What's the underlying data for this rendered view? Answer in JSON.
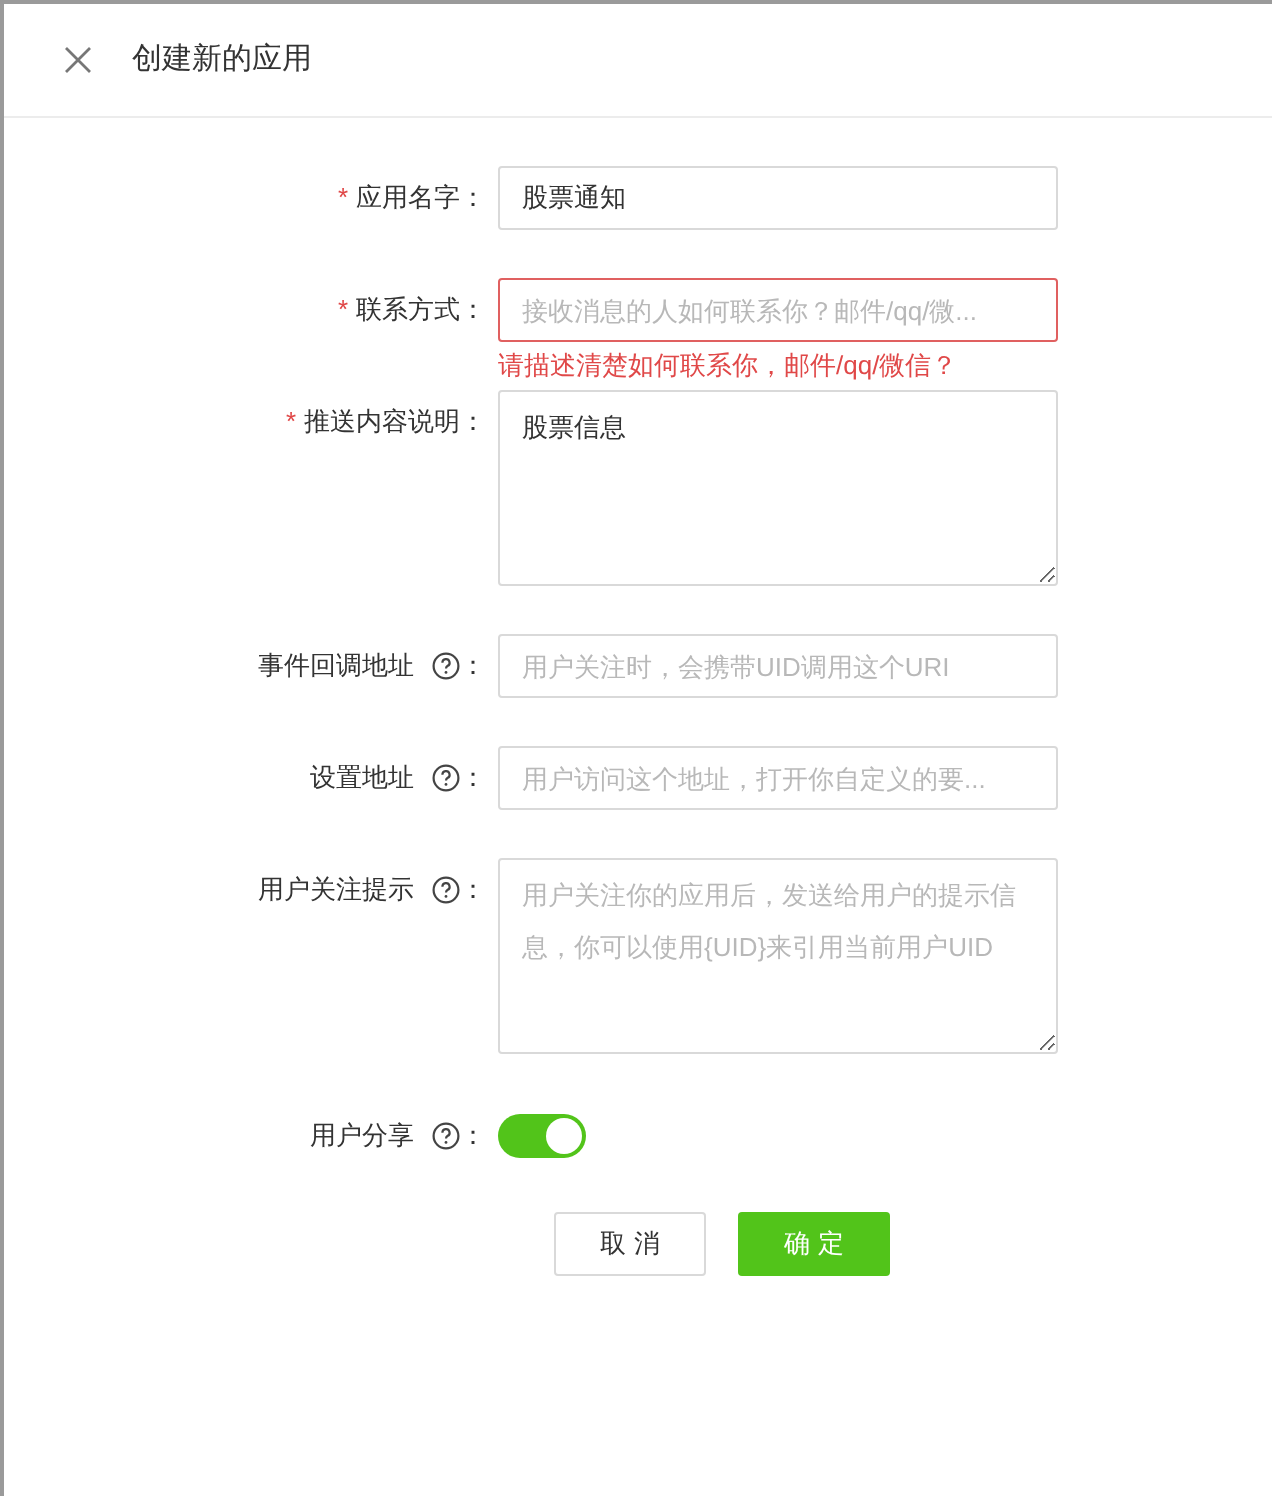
{
  "dialog": {
    "title": "创建新的应用"
  },
  "fields": [
    {
      "kind": "input",
      "required_mark": "*",
      "label": "应用名字",
      "colon": "：",
      "help": false,
      "value": "股票通知"
    },
    {
      "kind": "input",
      "required_mark": "*",
      "label": "联系方式",
      "colon": "：",
      "help": false,
      "placeholder": "接收消息的人如何联系你？邮件/qq/微...",
      "error": "请描述清楚如何联系你，邮件/qq/微信？"
    },
    {
      "kind": "textarea",
      "required_mark": "*",
      "label": "推送内容说明",
      "colon": "：",
      "help": false,
      "value": "股票信息"
    },
    {
      "kind": "input",
      "label": "事件回调地址",
      "colon": "：",
      "help": true,
      "placeholder": "用户关注时，会携带UID调用这个URI"
    },
    {
      "kind": "input",
      "label": "设置地址",
      "colon": "：",
      "help": true,
      "placeholder": "用户访问这个地址，打开你自定义的要..."
    },
    {
      "kind": "textarea",
      "label": "用户关注提示",
      "colon": "：",
      "help": true,
      "placeholder": "用户关注你的应用后，发送给用户的提示信息，你可以使用{UID}来引用当前用户UID"
    },
    {
      "kind": "switch",
      "label": "用户分享",
      "colon": "：",
      "help": true,
      "on": true
    }
  ],
  "buttons": [
    {
      "label": "取 消",
      "kind": "secondary"
    },
    {
      "label": "确 定",
      "kind": "primary"
    }
  ]
}
